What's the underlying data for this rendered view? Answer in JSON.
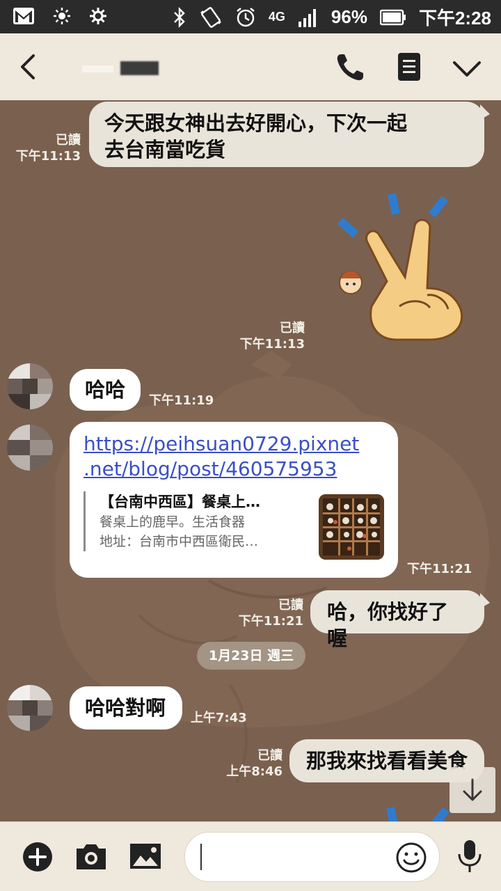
{
  "status_bar": {
    "battery": "96%",
    "time": "下午2:28",
    "network": "4G"
  },
  "header": {
    "back_icon": "chevron-left-icon",
    "call_icon": "phone-icon",
    "notes_icon": "notes-icon",
    "more_icon": "chevron-down-icon"
  },
  "messages": {
    "m1": {
      "text_line1": "今天跟女神出去好開心，下次一起",
      "text_line2": "去台南當吃貨",
      "read": "已讀",
      "time": "下午11:13"
    },
    "m2": {
      "sticker": "peace-sign-sticker",
      "read": "已讀",
      "time": "下午11:13"
    },
    "m3": {
      "text": "哈哈",
      "time": "下午11:19"
    },
    "m4": {
      "url_line1": "https://peihsuan0729.pixnet",
      "url_line2": ".net/blog/post/460575953",
      "preview_title": "【台南中西區】餐桌上…",
      "preview_desc1": "餐桌上的鹿早。生活食器",
      "preview_desc2": "地址：台南市中西區衛民…",
      "time": "下午11:21"
    },
    "m5": {
      "text": "哈，你找好了喔",
      "read": "已讀",
      "time": "下午11:21"
    },
    "date_separator": "1月23日 週三",
    "m6": {
      "text": "哈哈對啊",
      "time": "上午7:43"
    },
    "m7": {
      "text": "那我來找看看美食",
      "read": "已讀",
      "time": "上午8:46"
    }
  },
  "input_bar": {
    "add_icon": "plus-circle-icon",
    "camera_icon": "camera-icon",
    "gallery_icon": "image-icon",
    "emoji_icon": "emoji-icon",
    "mic_icon": "microphone-icon",
    "value": ""
  },
  "colors": {
    "background": "#7a604f",
    "header": "#efe8dc",
    "outgoing_bubble": "#e9e4da",
    "incoming_bubble": "#ffffff",
    "link": "#3a4fc7"
  }
}
